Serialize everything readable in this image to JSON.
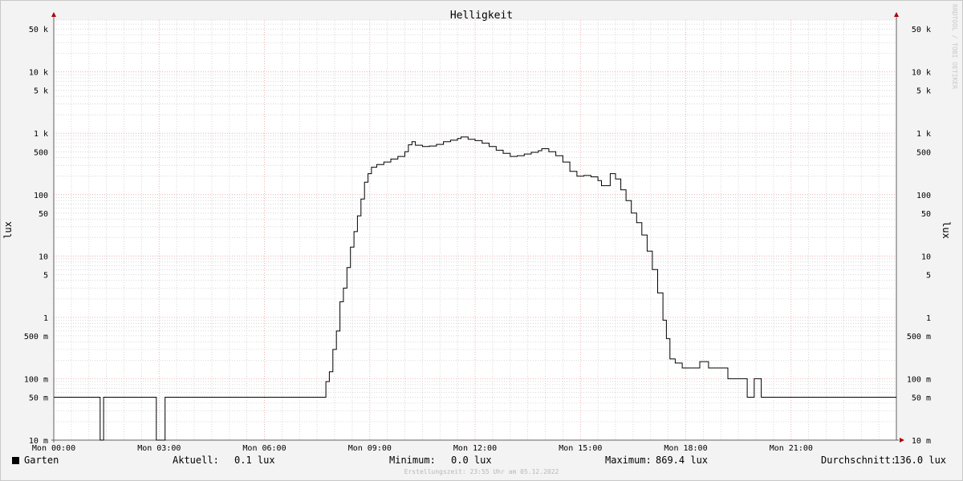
{
  "chart_data": {
    "type": "line",
    "title": "Helligkeit",
    "ylabel": "lux",
    "yscale": "log",
    "ylim": [
      0.01,
      70000
    ],
    "xlim": [
      "Mon 00:00",
      "Mon 24:00"
    ],
    "y_ticks": [
      {
        "value": 50000,
        "label": "50 k"
      },
      {
        "value": 10000,
        "label": "10 k"
      },
      {
        "value": 5000,
        "label": "5 k"
      },
      {
        "value": 1000,
        "label": "1 k"
      },
      {
        "value": 500,
        "label": "500"
      },
      {
        "value": 100,
        "label": "100"
      },
      {
        "value": 50,
        "label": "50"
      },
      {
        "value": 10,
        "label": "10"
      },
      {
        "value": 5,
        "label": "5"
      },
      {
        "value": 1,
        "label": "1"
      },
      {
        "value": 0.5,
        "label": "500 m"
      },
      {
        "value": 0.1,
        "label": "100 m"
      },
      {
        "value": 0.05,
        "label": "50 m"
      },
      {
        "value": 0.01,
        "label": "10 m"
      }
    ],
    "x_ticks": [
      {
        "hour": 0,
        "label": "Mon 00:00"
      },
      {
        "hour": 3,
        "label": "Mon 03:00"
      },
      {
        "hour": 6,
        "label": "Mon 06:00"
      },
      {
        "hour": 9,
        "label": "Mon 09:00"
      },
      {
        "hour": 12,
        "label": "Mon 12:00"
      },
      {
        "hour": 15,
        "label": "Mon 15:00"
      },
      {
        "hour": 18,
        "label": "Mon 18:00"
      },
      {
        "hour": 21,
        "label": "Mon 21:00"
      }
    ],
    "grid": true,
    "legend_position": "bottom-left",
    "series": [
      {
        "name": "Garten",
        "color": "#000000",
        "points": [
          [
            0.0,
            0.05
          ],
          [
            1.3,
            0.05
          ],
          [
            1.32,
            0.01
          ],
          [
            1.4,
            0.01
          ],
          [
            1.42,
            0.05
          ],
          [
            2.9,
            0.05
          ],
          [
            2.92,
            0.01
          ],
          [
            3.15,
            0.01
          ],
          [
            3.17,
            0.05
          ],
          [
            7.65,
            0.05
          ],
          [
            7.75,
            0.09
          ],
          [
            7.85,
            0.13
          ],
          [
            7.95,
            0.3
          ],
          [
            8.05,
            0.6
          ],
          [
            8.15,
            1.8
          ],
          [
            8.25,
            3.0
          ],
          [
            8.35,
            6.5
          ],
          [
            8.45,
            14
          ],
          [
            8.55,
            25
          ],
          [
            8.65,
            45
          ],
          [
            8.75,
            85
          ],
          [
            8.85,
            160
          ],
          [
            8.95,
            220
          ],
          [
            9.05,
            280
          ],
          [
            9.2,
            310
          ],
          [
            9.4,
            340
          ],
          [
            9.6,
            380
          ],
          [
            9.8,
            420
          ],
          [
            10.0,
            500
          ],
          [
            10.1,
            650
          ],
          [
            10.2,
            730
          ],
          [
            10.3,
            640
          ],
          [
            10.5,
            610
          ],
          [
            10.7,
            620
          ],
          [
            10.9,
            660
          ],
          [
            11.1,
            730
          ],
          [
            11.3,
            770
          ],
          [
            11.5,
            820
          ],
          [
            11.6,
            869.4
          ],
          [
            11.8,
            800
          ],
          [
            12.0,
            760
          ],
          [
            12.2,
            690
          ],
          [
            12.4,
            610
          ],
          [
            12.6,
            530
          ],
          [
            12.8,
            470
          ],
          [
            13.0,
            420
          ],
          [
            13.2,
            430
          ],
          [
            13.4,
            460
          ],
          [
            13.6,
            490
          ],
          [
            13.8,
            520
          ],
          [
            13.9,
            560
          ],
          [
            14.1,
            500
          ],
          [
            14.3,
            430
          ],
          [
            14.5,
            340
          ],
          [
            14.7,
            240
          ],
          [
            14.9,
            200
          ],
          [
            15.1,
            205
          ],
          [
            15.3,
            195
          ],
          [
            15.5,
            170
          ],
          [
            15.6,
            140
          ],
          [
            15.75,
            140
          ],
          [
            15.85,
            220
          ],
          [
            16.0,
            180
          ],
          [
            16.15,
            120
          ],
          [
            16.3,
            80
          ],
          [
            16.45,
            50
          ],
          [
            16.6,
            35
          ],
          [
            16.75,
            22
          ],
          [
            16.9,
            12
          ],
          [
            17.05,
            6
          ],
          [
            17.2,
            2.5
          ],
          [
            17.35,
            0.9
          ],
          [
            17.45,
            0.45
          ],
          [
            17.55,
            0.21
          ],
          [
            17.7,
            0.18
          ],
          [
            17.9,
            0.15
          ],
          [
            18.35,
            0.15
          ],
          [
            18.4,
            0.19
          ],
          [
            18.6,
            0.19
          ],
          [
            18.65,
            0.15
          ],
          [
            19.15,
            0.15
          ],
          [
            19.2,
            0.1
          ],
          [
            19.7,
            0.1
          ],
          [
            19.75,
            0.05
          ],
          [
            19.9,
            0.05
          ],
          [
            19.95,
            0.1
          ],
          [
            20.1,
            0.1
          ],
          [
            20.15,
            0.05
          ],
          [
            24.0,
            0.05
          ]
        ]
      }
    ]
  },
  "vertical_label": "RRDTOOL / TOBI OETIKER",
  "legend": {
    "series_name": "Garten",
    "series_color": "#000000",
    "current_label": "Aktuell:",
    "current_value": "0.1 lux",
    "min_label": "Minimum:",
    "min_value": "0.0 lux",
    "max_label": "Maximum:",
    "max_value": "869.4 lux",
    "avg_label": "Durchschnitt:",
    "avg_value": "136.0 lux"
  },
  "footer": "Erstellungszeit: 23:55 Uhr am 05.12.2022",
  "colors": {
    "background": "#f3f3f3",
    "plot_bg": "#ffffff",
    "major_grid": "#e8a0a0",
    "minor_grid": "#cfcfcf",
    "axis": "#606060",
    "arrow": "#aa0000"
  }
}
